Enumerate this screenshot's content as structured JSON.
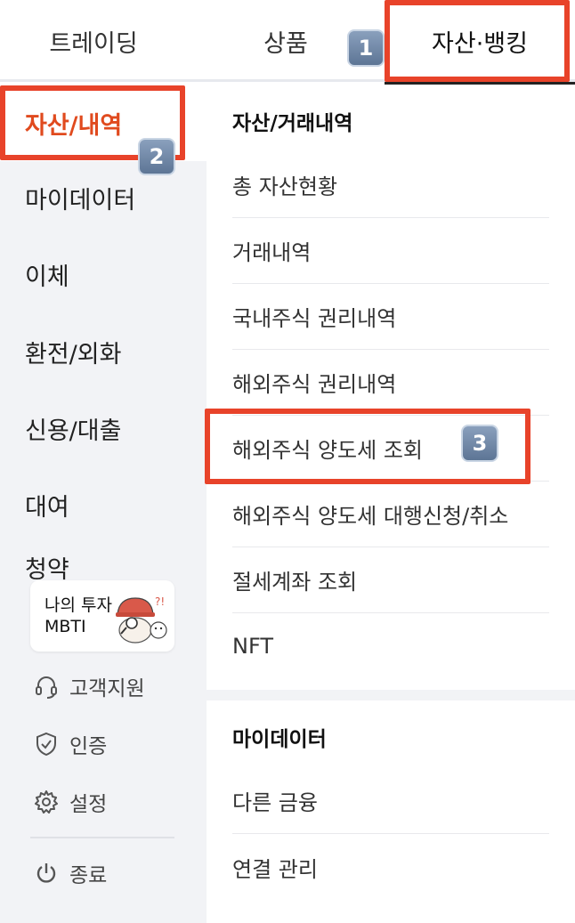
{
  "top_tabs": [
    {
      "label": "트레이딩"
    },
    {
      "label": "상품"
    },
    {
      "label": "자산·뱅킹",
      "selected": true
    }
  ],
  "left_menu": {
    "items": [
      {
        "label": "자산/내역",
        "active": true
      },
      {
        "label": "마이데이터"
      },
      {
        "label": "이체"
      },
      {
        "label": "환전/외화"
      },
      {
        "label": "신용/대출"
      },
      {
        "label": "대여"
      },
      {
        "label": "청약"
      }
    ],
    "promo": {
      "line1": "나의 투자",
      "line2": "MBTI",
      "art_icon": "character-with-magnifier-icon"
    },
    "utilities": [
      {
        "label": "고객지원",
        "icon": "headset-icon"
      },
      {
        "label": "인증",
        "icon": "shield-check-icon"
      },
      {
        "label": "설정",
        "icon": "gear-icon"
      },
      {
        "label": "종료",
        "icon": "power-icon"
      }
    ]
  },
  "sections": [
    {
      "title": "자산/거래내역",
      "items": [
        {
          "label": "총 자산현황"
        },
        {
          "label": "거래내역"
        },
        {
          "label": "국내주식 권리내역"
        },
        {
          "label": "해외주식 권리내역"
        },
        {
          "label": "해외주식 양도세 조회"
        },
        {
          "label": "해외주식 양도세 대행신청/취소"
        },
        {
          "label": "절세계좌 조회"
        },
        {
          "label": "NFT"
        }
      ]
    },
    {
      "title": "마이데이터",
      "items": [
        {
          "label": "다른 금융"
        },
        {
          "label": "연결 관리"
        }
      ]
    }
  ],
  "annotations": {
    "badge_1": "1",
    "badge_2": "2",
    "badge_3": "3",
    "highlight_color": "#e8432a"
  },
  "colors": {
    "accent": "#e04a1e",
    "panel_bg": "#f2f3f6"
  }
}
